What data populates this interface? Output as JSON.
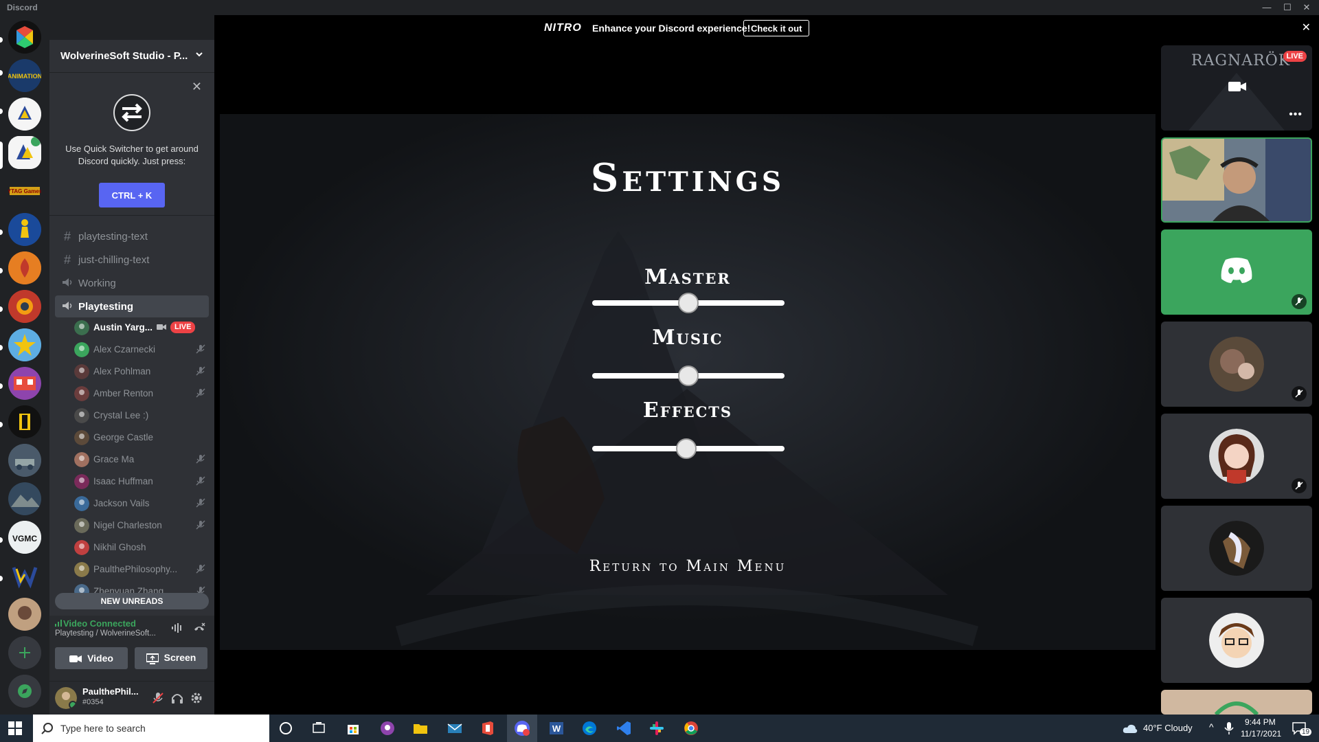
{
  "app": {
    "title": "Discord"
  },
  "window_controls": {
    "minimize": "—",
    "maximize": "☐",
    "close": "✕"
  },
  "nitro_banner": {
    "logo": "NITRO",
    "message": "Enhance your Discord experience!",
    "cta": "Check it out"
  },
  "server": {
    "name": "WolverineSoft Studio - P..."
  },
  "quick_switcher": {
    "text": "Use Quick Switcher to get around Discord quickly. Just press:",
    "shortcut": "CTRL + K"
  },
  "channels": [
    {
      "type": "text",
      "name": "playtesting-text"
    },
    {
      "type": "text",
      "name": "just-chilling-text"
    },
    {
      "type": "voice",
      "name": "Working"
    },
    {
      "type": "voice",
      "name": "Playtesting",
      "active": true
    }
  ],
  "voice_users": [
    {
      "name": "Austin Yarg...",
      "live": true,
      "live_label": "LIVE",
      "color": "#3b6e4e"
    },
    {
      "name": "Alex Czarnecki",
      "muted": true,
      "color": "#3ba55d"
    },
    {
      "name": "Alex Pohlman",
      "muted": true,
      "color": "#5a3a3a"
    },
    {
      "name": "Amber Renton",
      "muted": true,
      "color": "#6b3d3d"
    },
    {
      "name": "Crystal Lee :)",
      "muted": false,
      "color": "#4a4a4a"
    },
    {
      "name": "George Castle",
      "muted": false,
      "color": "#5c4a3a"
    },
    {
      "name": "Grace Ma",
      "muted": true,
      "color": "#a07060"
    },
    {
      "name": "Isaac Huffman",
      "muted": true,
      "color": "#7a2a5a"
    },
    {
      "name": "Jackson Vails",
      "muted": true,
      "color": "#3a6a9a"
    },
    {
      "name": "Nigel Charleston",
      "muted": true,
      "color": "#6a6a5a"
    },
    {
      "name": "Nikhil Ghosh",
      "muted": false,
      "color": "#c04040"
    },
    {
      "name": "PaulthePhilosophy...",
      "muted": true,
      "color": "#8a7a4a"
    },
    {
      "name": "Zhenyuan Zhang",
      "muted": true,
      "color": "#4a6a8a"
    }
  ],
  "new_unreads": "NEW UNREADS",
  "rtc": {
    "status": "Video Connected",
    "location": "Playtesting / WolverineSoft...",
    "video_label": "Video",
    "screen_label": "Screen"
  },
  "user": {
    "name": "PaulthePhil...",
    "tag": "#0354"
  },
  "game": {
    "title": "Settings",
    "sliders": [
      {
        "label": "Master",
        "value": 0.5
      },
      {
        "label": "Music",
        "value": 0.5
      },
      {
        "label": "Effects",
        "value": 0.49
      }
    ],
    "return_label": "Return to Main Menu"
  },
  "tiles": [
    {
      "kind": "stream",
      "title": "RAGNARÖK",
      "live_label": "LIVE"
    },
    {
      "kind": "camera"
    },
    {
      "kind": "discord",
      "color": "#3ba55d"
    },
    {
      "kind": "avatar",
      "color": "#5a4a3a"
    },
    {
      "kind": "avatar",
      "color": "#7a4a4a"
    },
    {
      "kind": "avatar",
      "color": "#4a5a7a"
    },
    {
      "kind": "avatar",
      "color": "#d0c0b0"
    },
    {
      "kind": "partial"
    }
  ],
  "taskbar": {
    "search_placeholder": "Type here to search",
    "weather": "40°F  Cloudy",
    "time": "9:44 PM",
    "date": "11/17/2021",
    "notifications": "19"
  }
}
